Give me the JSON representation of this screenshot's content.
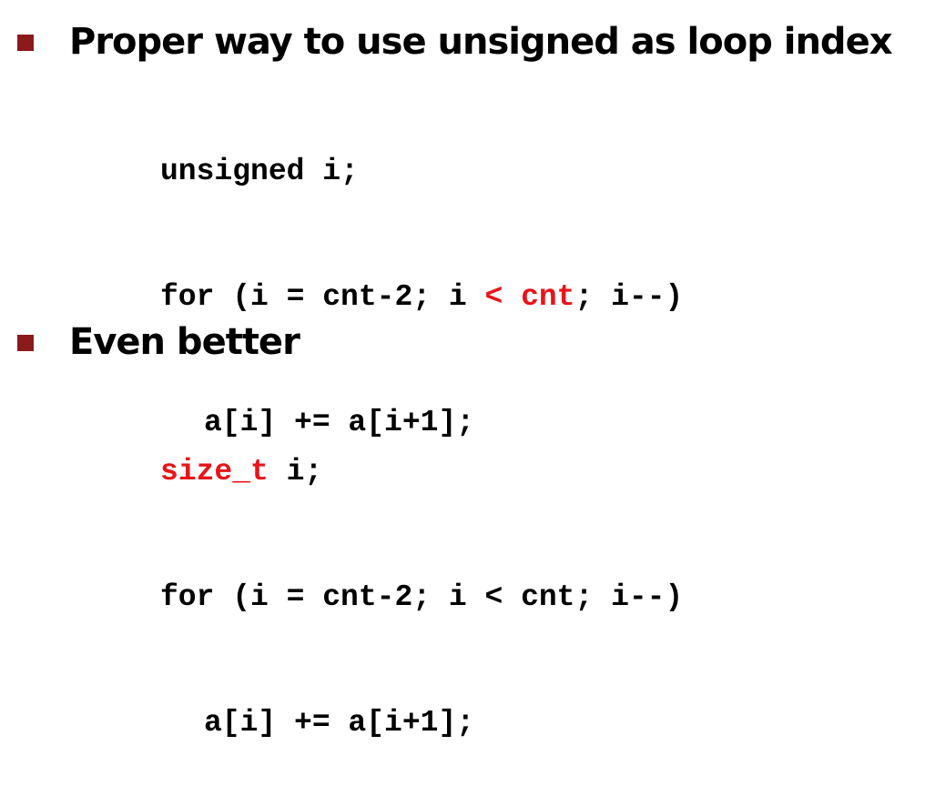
{
  "colors": {
    "bullet": "#8b1a1a",
    "highlight": "#e8141a",
    "text": "#000000"
  },
  "section1": {
    "heading": "Proper way to use unsigned as loop index",
    "code": {
      "line1": "unsigned i;",
      "line2_a": "for (i = cnt-2; i ",
      "line2_hl": "< cnt",
      "line2_b": "; i--)",
      "line3": "a[i] += a[i+1];"
    }
  },
  "section2": {
    "heading": "Even better",
    "code": {
      "line1_hl": "size_t",
      "line1_b": " i;",
      "line2": "for (i = cnt-2; i < cnt; i--)",
      "line3": "a[i] += a[i+1];"
    }
  }
}
